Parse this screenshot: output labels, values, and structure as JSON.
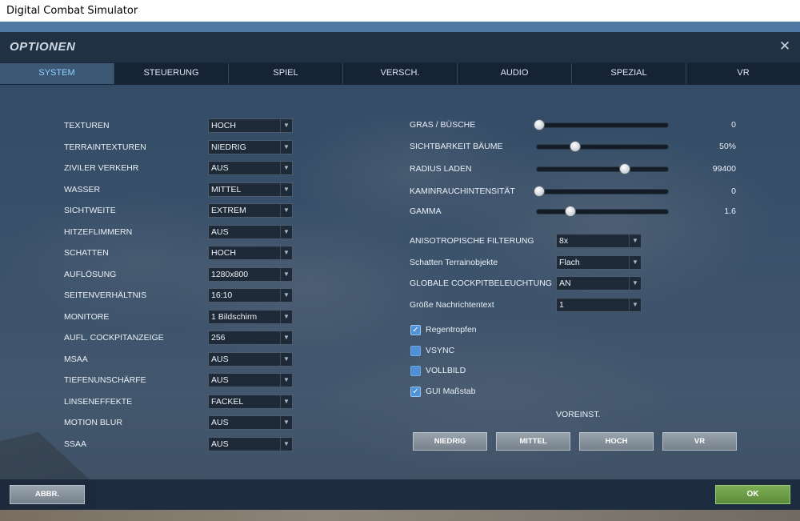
{
  "window": {
    "title": "Digital Combat Simulator"
  },
  "dialog": {
    "title": "OPTIONEN",
    "close_symbol": "✕"
  },
  "tabs": [
    {
      "label": "SYSTEM",
      "active": true
    },
    {
      "label": "STEUERUNG"
    },
    {
      "label": "SPIEL"
    },
    {
      "label": "VERSCH."
    },
    {
      "label": "AUDIO"
    },
    {
      "label": "SPEZIAL"
    },
    {
      "label": "VR"
    }
  ],
  "left_settings": [
    {
      "label": "TEXTUREN",
      "value": "HOCH"
    },
    {
      "label": "TERRAINTEXTUREN",
      "value": "NIEDRIG"
    },
    {
      "label": "ZIVILER VERKEHR",
      "value": "AUS"
    },
    {
      "label": "WASSER",
      "value": "MITTEL"
    },
    {
      "label": "SICHTWEITE",
      "value": "EXTREM"
    },
    {
      "label": "HITZEFLIMMERN",
      "value": "AUS"
    },
    {
      "label": "SCHATTEN",
      "value": "HOCH"
    },
    {
      "label": "AUFLÖSUNG",
      "value": "1280x800"
    },
    {
      "label": "SEITENVERHÄLTNIS",
      "value": "16:10"
    },
    {
      "label": "MONITORE",
      "value": "1 Bildschirm"
    },
    {
      "label": "AUFL. COCKPITANZEIGE",
      "value": "256"
    },
    {
      "label": "MSAA",
      "value": "AUS"
    },
    {
      "label": "TIEFENUNSCHÄRFE",
      "value": "AUS"
    },
    {
      "label": "LINSENEFFEKTE",
      "value": "FACKEL"
    },
    {
      "label": "MOTION BLUR",
      "value": "AUS"
    },
    {
      "label": "SSAA",
      "value": "AUS"
    }
  ],
  "sliders": [
    {
      "label": "GRAS / BÜSCHE",
      "value": "0",
      "level": 0.02
    },
    {
      "label": "SICHTBARKEIT BÄUME",
      "value": "50%",
      "level": 0.29
    },
    {
      "label": "RADIUS LADEN",
      "value": "99400",
      "level": 0.66
    },
    {
      "label": "KAMINRAUCHINTENSITÄT",
      "value": "0",
      "level": 0.02
    },
    {
      "label": "GAMMA",
      "value": "1.6",
      "level": 0.25
    }
  ],
  "right_settings": [
    {
      "label": "ANISOTROPISCHE FILTERUNG",
      "value": "8x"
    },
    {
      "label": "Schatten Terrainobjekte",
      "value": "Flach"
    },
    {
      "label": "GLOBALE COCKPITBELEUCHTUNG",
      "value": "AN"
    },
    {
      "label": "Größe Nachrichtentext",
      "value": "1"
    }
  ],
  "checkboxes": [
    {
      "label": "Regentropfen",
      "checked": true
    },
    {
      "label": "VSYNC",
      "checked": false
    },
    {
      "label": "VOLLBILD",
      "checked": false
    },
    {
      "label": "GUI Maßstab",
      "checked": true
    }
  ],
  "presets": {
    "title": "VOREINST.",
    "buttons": [
      "NIEDRIG",
      "MITTEL",
      "HOCH",
      "VR"
    ]
  },
  "footer": {
    "cancel_label": "ABBR.",
    "ok_label": "OK"
  },
  "icons": {
    "dropdown": "▼",
    "check": "✓"
  }
}
